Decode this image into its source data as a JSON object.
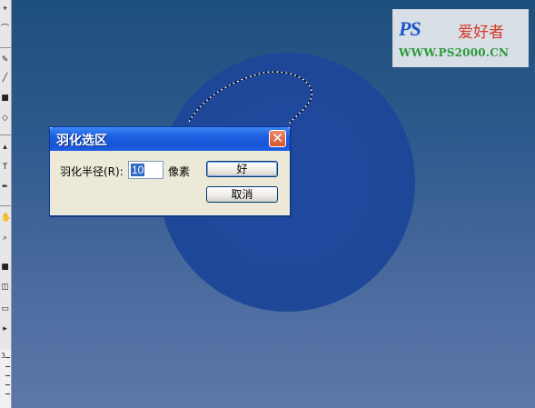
{
  "dialog": {
    "title": "羽化选区",
    "field_label": "羽化半径(R):",
    "radius_value": "10",
    "unit": "像素",
    "ok_label": "好",
    "cancel_label": "取消",
    "close_glyph": "✕"
  },
  "watermark": {
    "logo": "PS",
    "title": "爱好者",
    "url": "WWW.PS2000.CN"
  },
  "ruler": {
    "label": "3"
  },
  "icons": [
    "close-icon",
    "lasso-tool-icon",
    "brush-tool-icon",
    "eraser-tool-icon",
    "text-tool-icon",
    "zoom-tool-icon"
  ],
  "colors": {
    "canvas_top": "#1d4f7c",
    "canvas_bottom": "#5d78aa",
    "circle": "#1f4798",
    "title_bar": "#1e5fe0",
    "close_button": "#d9542f",
    "dialog_bg": "#ece9d8",
    "watermark_blue": "#1e55c8",
    "watermark_red": "#d63a2a",
    "watermark_green": "#2a9a3a"
  }
}
